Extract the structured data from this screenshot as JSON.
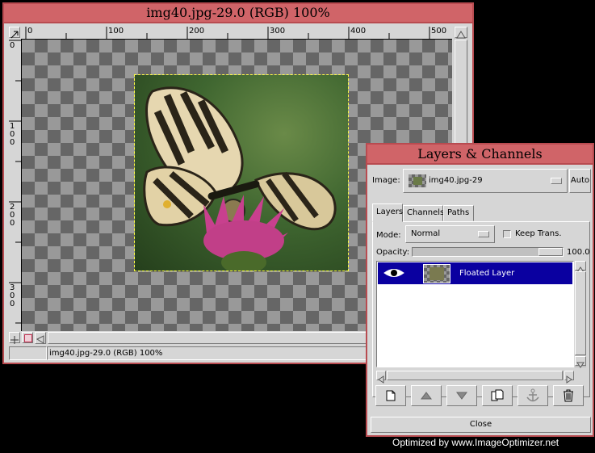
{
  "image_window": {
    "title": "img40.jpg-29.0 (RGB) 100%",
    "ruler_h_ticks": [
      "0",
      "100",
      "200",
      "300",
      "400",
      "500"
    ],
    "ruler_v_ticks": [
      "0",
      "100",
      "200",
      "300"
    ],
    "status_text": "img40.jpg-29.0 (RGB) 100%"
  },
  "layers_dialog": {
    "title": "Layers & Channels",
    "image_label": "Image:",
    "image_value": "img40.jpg-29",
    "auto_button": "Auto",
    "tabs": [
      "Layers",
      "Channels",
      "Paths"
    ],
    "mode_label": "Mode:",
    "mode_value": "Normal",
    "keep_trans_label": "Keep Trans.",
    "opacity_label": "Opacity:",
    "opacity_value": "100.0",
    "layers": [
      {
        "name": "Floated Layer",
        "visible": true,
        "selected": true
      }
    ],
    "toolbar_icons": [
      "new-layer-icon",
      "raise-layer-icon",
      "lower-layer-icon",
      "duplicate-layer-icon",
      "anchor-layer-icon",
      "delete-layer-icon"
    ],
    "close_label": "Close"
  },
  "watermark": "Optimized by www.ImageOptimizer.net",
  "colors": {
    "title_bg": "#d06468",
    "window_bg": "#d6d6d6",
    "selected_row": "#0a00a0"
  }
}
